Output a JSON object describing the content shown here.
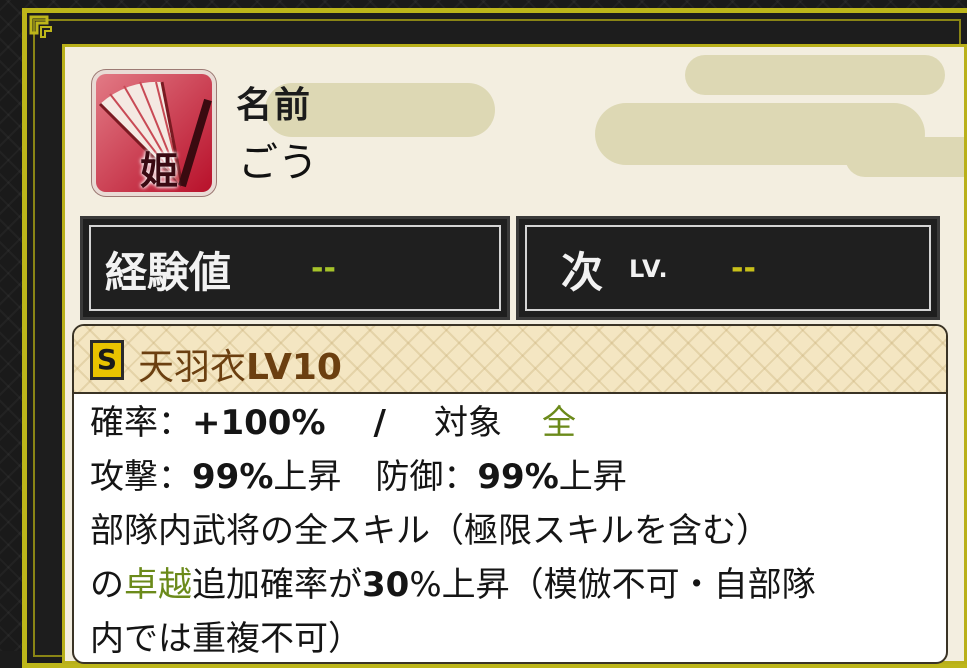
{
  "profile": {
    "name_label": "名前",
    "name_value": "ごう",
    "avatar_badge": "姫"
  },
  "stats": {
    "exp_label": "経験値",
    "exp_value": "--",
    "next_label": "次",
    "next_small": "LV.",
    "next_value": "--"
  },
  "skill": {
    "rank": "S",
    "name": "天羽衣",
    "level": "LV10",
    "rate_label": "確率：",
    "rate_value": "+100%",
    "separator": "/",
    "target_label": "対象",
    "target_value": "全",
    "attack_label": "攻撃：",
    "attack_value": "99%",
    "attack_suffix": "上昇",
    "defense_label": "防御：",
    "defense_value": "99%",
    "defense_suffix": "上昇",
    "desc_line1": "部隊内武将の全スキル（極限スキルを含む）",
    "desc_line2_prefix": "の",
    "desc_line2_highlight": "卓越",
    "desc_line2_mid": "追加確率が",
    "desc_line2_value": "30",
    "desc_line2_suffix": "%上昇（模倣不可・自部隊",
    "desc_line3": "内では重複不可）"
  },
  "colors": {
    "frame": "#bdb61a",
    "value_green": "#a6c32a",
    "highlight_green": "#6b8a1a",
    "rank_badge": "#e9c300",
    "skill_name": "#6b3f10"
  }
}
